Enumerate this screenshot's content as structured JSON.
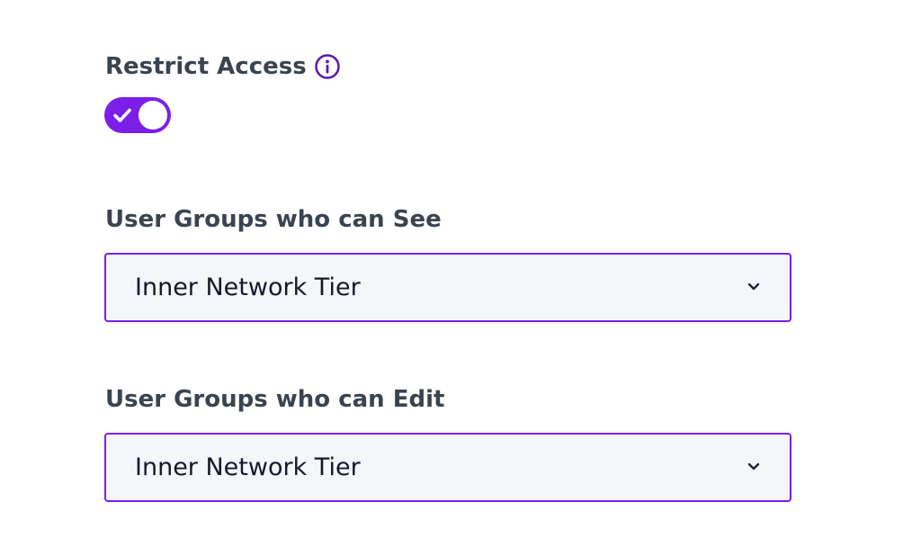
{
  "restrict_access": {
    "label": "Restrict Access",
    "info_icon": "info-icon",
    "toggle_checked": true,
    "toggle_icon": "check-icon"
  },
  "see_group": {
    "label": "User Groups who can See",
    "selected_value": "Inner Network Tier",
    "icon": "chevron-down-icon"
  },
  "edit_group": {
    "label": "User Groups who can Edit",
    "selected_value": "Inner Network Tier",
    "icon": "chevron-down-icon"
  },
  "colors": {
    "accent": "#7b1fe8",
    "label_text": "#3a4451",
    "value_text": "#121a2a",
    "field_background": "#f5f6fa"
  }
}
